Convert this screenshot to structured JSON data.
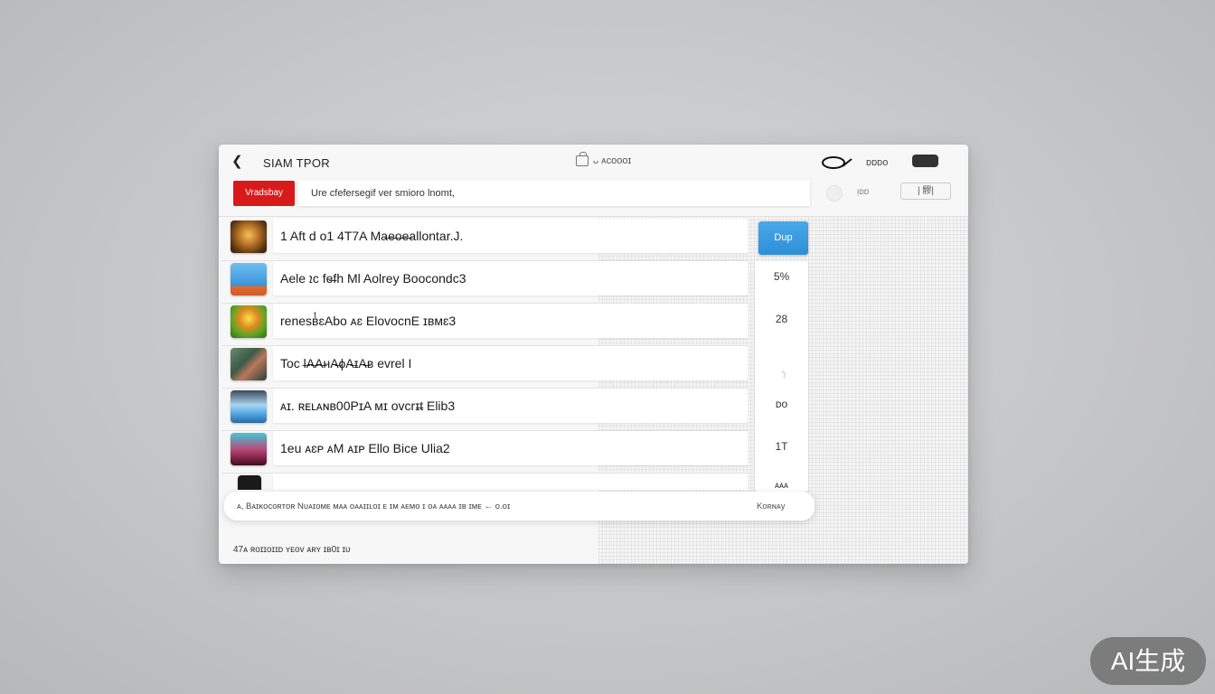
{
  "titlebar": {
    "back_glyph": "❮",
    "app_title": "SIAM TPOR",
    "center_title": "ᴗ ᴀᴄᴏᴏᴏɪ",
    "top_label": "ᴅᴅᴅᴏ",
    "search_icon": "search-icon"
  },
  "toolbar": {
    "red_button": "Vradsbay",
    "address_value": "Ure cfefersegif ver smioro lnomt,",
    "tb_label": "ᴉᴅᴅ",
    "tb_button": "| 髎|"
  },
  "rows": [
    {
      "name": "1 Aft d o1 4T7A  Ma̶e̶o̶e̶allontar.J.",
      "side": ""
    },
    {
      "name": "Aele  ܐc fe̶fh Ml  Aolrey Boocondc3",
      "side": "5%"
    },
    {
      "name": "renesʙͭɛAbo ᴀɛ ElovocnE ɪʙᴍɛ3",
      "side": "28"
    },
    {
      "name": "Toc l̶A̶A̶ʜA̶ɸA̶ɪA̶ʙ evrel I",
      "side": ""
    },
    {
      "name": "ᴀɪ. ʀᴇʟᴀɴʙ00PɪA ᴍɪ ovcrɪ̶t  Elib3",
      "side": ""
    },
    {
      "name": "1eu  ᴀɛᴘ ᴀM ᴀɪᴘ Ello  Bice  Ulia2",
      "side": "1T"
    },
    {
      "name": "",
      "side": ""
    }
  ],
  "side_column": {
    "blue_button": "Dup",
    "values": [
      "5%",
      "28",
      "ᴅᴏ",
      "1T",
      "ᴀᴀᴀ"
    ]
  },
  "status": {
    "text": "ᴀ, Bᴀɪᴋᴏᴄᴏʀᴛᴏʀ  Nᴜᴀɪᴏᴍᴇ   ᴍᴀᴀ ᴏᴀᴀɪɪʟᴏɪ  ᴇ   ɪᴍ ᴀᴇᴍᴏ   ɪ ᴏᴀ ᴀᴀᴀᴀ ɪʙ ɪᴍᴇ  ← ᴏ.ᴏɪ",
    "right": "Kᴏʀɴᴀy"
  },
  "footer": {
    "text": "47ᴀ   ʀᴏɪɪᴏɪɪᴅ ʏᴇᴏᴠ ᴀʀʏ ɪʙ0ɪ ɪᴜ"
  },
  "badge": {
    "text": "AI生成"
  },
  "colors": {
    "accent_red": "#d91a1a",
    "accent_blue": "#2e8fd8"
  }
}
